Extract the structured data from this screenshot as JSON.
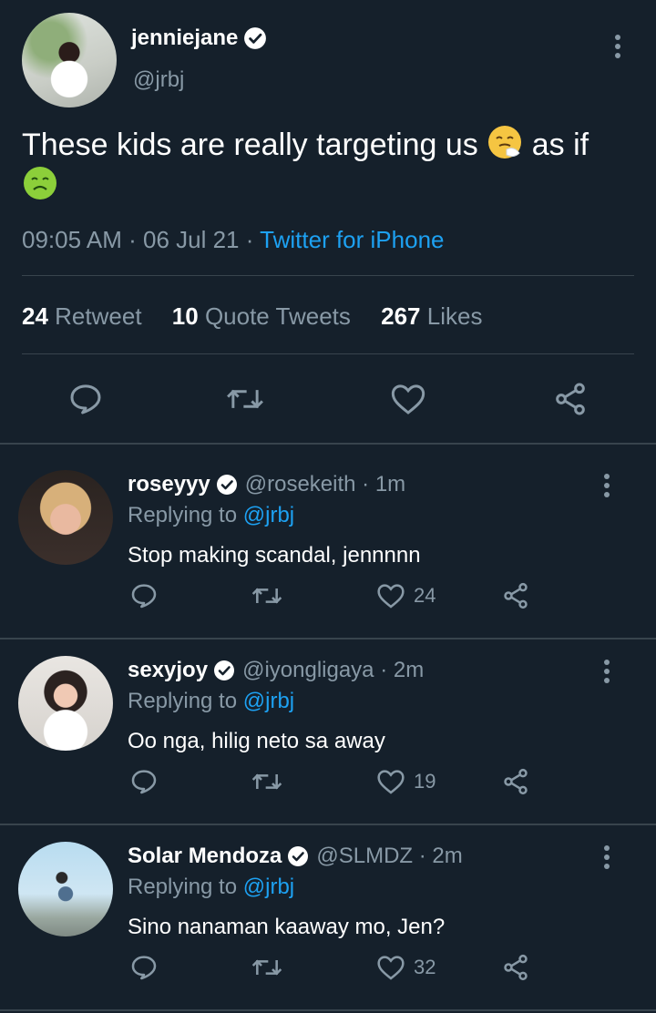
{
  "main_tweet": {
    "display_name": "jenniejane",
    "handle": "@jrbj",
    "text": "These kids are really targeting us",
    "text_after_emoji": "as if",
    "emoji_1": "sneezing-face-emoji",
    "emoji_2": "nauseated-face-emoji",
    "time": "09:05 AM",
    "date": "06 Jul 21",
    "source": "Twitter for iPhone",
    "retweets_count": "24",
    "retweets_label": "Retweet",
    "quotes_count": "10",
    "quotes_label": "Quote Tweets",
    "likes_count": "267",
    "likes_label": "Likes"
  },
  "replies": [
    {
      "display_name": "roseyyy",
      "handle": "@rosekeith",
      "time": "1m",
      "replying_prefix": "Replying to",
      "replying_to": "@jrbj",
      "text": "Stop making scandal, jennnnn",
      "likes": "24"
    },
    {
      "display_name": "sexyjoy",
      "handle": "@iyongligaya",
      "time": "2m",
      "replying_prefix": "Replying to",
      "replying_to": "@jrbj",
      "text": "Oo nga, hilig neto sa away",
      "likes": "19"
    },
    {
      "display_name": "Solar Mendoza",
      "handle": "@SLMDZ",
      "time": "2m",
      "replying_prefix": "Replying to",
      "replying_to": "@jrbj",
      "text": "Sino nanaman kaaway mo, Jen?",
      "likes": "32"
    }
  ],
  "colors": {
    "background": "#15202b",
    "muted": "#8899a6",
    "accent": "#1da1f2",
    "divider": "#38444d"
  }
}
